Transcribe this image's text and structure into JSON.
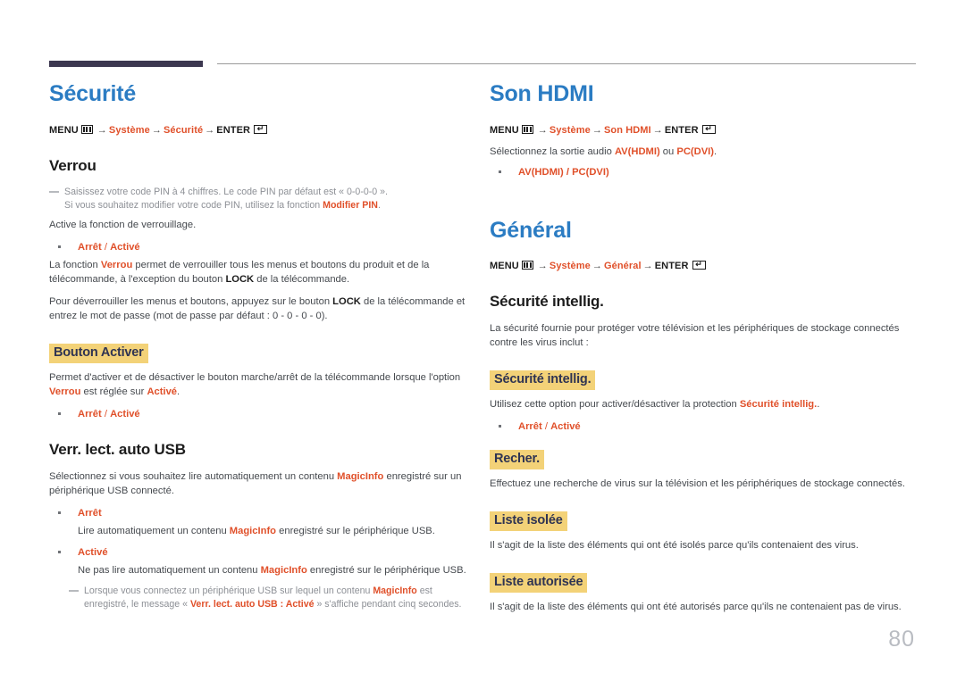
{
  "page": {
    "number": "80"
  },
  "left_column": {
    "title": "Sécurité",
    "menu_path": {
      "menu_label": "MENU",
      "arrow": "→",
      "item1": "Système",
      "item2": "Sécurité",
      "enter_label": "ENTER"
    },
    "verrou": {
      "heading": "Verrou",
      "note1_part1": "Saisissez votre code PIN à 4 chiffres. Le code PIN par défaut est « 0-0-0-0 ».",
      "note1_part2": "Si vous souhaitez modifier votre code PIN, utilisez la fonction ",
      "note1_accent": "Modifier PIN",
      "note1_part3": ".",
      "intro": "Active la fonction de verrouillage.",
      "bullet_off": "Arrêt",
      "bullet_sep": " / ",
      "bullet_on": "Activé",
      "para1_part1": "La fonction ",
      "para1_accent1": "Verrou",
      "para1_part2": " permet de verrouiller tous les menus et boutons du produit et de la télécommande, à l'exception du bouton ",
      "para1_bold1": "LOCK",
      "para1_part3": " de la télécommande.",
      "para2_part1": "Pour déverrouiller les menus et boutons, appuyez sur le bouton ",
      "para2_bold1": "LOCK",
      "para2_part2": " de la télécommande et entrez le mot de passe (mot de passe par défaut : 0 - 0 - 0 - 0)."
    },
    "bouton_activer": {
      "label": "Bouton Activer",
      "para_part1": "Permet d'activer et de désactiver le bouton marche/arrêt de la télécommande lorsque l'option ",
      "para_accent1": "Verrou",
      "para_part2": " est réglée sur ",
      "para_accent2": "Activé",
      "para_part3": ".",
      "bullet_off": "Arrêt",
      "bullet_sep": " / ",
      "bullet_on": "Activé"
    },
    "verr_lect": {
      "heading": "Verr. lect. auto USB",
      "intro_part1": "Sélectionnez si vous souhaitez lire automatiquement un contenu ",
      "intro_accent": "MagicInfo",
      "intro_part2": " enregistré sur un périphérique USB connecté.",
      "option1_label": "Arrêt",
      "option1_desc_part1": "Lire automatiquement un contenu ",
      "option1_desc_accent": "MagicInfo",
      "option1_desc_part2": " enregistré sur le périphérique USB.",
      "option2_label": "Activé",
      "option2_desc_part1": "Ne pas lire automatiquement un contenu ",
      "option2_desc_accent": "MagicInfo",
      "option2_desc_part2": " enregistré sur le périphérique USB.",
      "note_part1": "Lorsque vous connectez un périphérique USB sur lequel un contenu ",
      "note_accent1": "MagicInfo",
      "note_part2": " est enregistré, le message « ",
      "note_accent2": "Verr. lect. auto USB : Activé",
      "note_part3": " » s'affiche pendant cinq secondes."
    }
  },
  "right_column": {
    "son_hdmi": {
      "title": "Son HDMI",
      "menu_path": {
        "menu_label": "MENU",
        "arrow": "→",
        "item1": "Système",
        "item2": "Son HDMI",
        "enter_label": "ENTER"
      },
      "intro_part1": "Sélectionnez la sortie audio ",
      "intro_accent1": "AV(HDMI)",
      "intro_part2": " ou ",
      "intro_accent2": "PC(DVI)",
      "intro_part3": ".",
      "bullet": "AV(HDMI) / PC(DVI)"
    },
    "general": {
      "title": "Général",
      "menu_path": {
        "menu_label": "MENU",
        "arrow": "→",
        "item1": "Système",
        "item2": "Général",
        "enter_label": "ENTER"
      },
      "heading": "Sécurité intellig.",
      "intro": "La sécurité fournie pour protéger votre télévision et les périphériques de stockage connectés contre les virus inclut :",
      "securite_intellig": {
        "label": "Sécurité intellig.",
        "para_part1": "Utilisez cette option pour activer/désactiver la protection ",
        "para_accent": "Sécurité intellig.",
        "para_part2": ".",
        "bullet_off": "Arrêt",
        "bullet_sep": " / ",
        "bullet_on": "Activé"
      },
      "recher": {
        "label": "Recher.",
        "para": "Effectuez une recherche de virus sur la télévision et les périphériques de stockage connectés."
      },
      "liste_isolee": {
        "label": "Liste isolée",
        "para": "Il s'agit de la liste des éléments qui ont été isolés parce qu'ils contenaient des virus."
      },
      "liste_autorisee": {
        "label": "Liste autorisée",
        "para": "Il s'agit de la liste des éléments qui ont été autorisés parce qu'ils ne contenaient pas de virus."
      }
    }
  },
  "colors": {
    "heading_blue": "#2b7cc3",
    "accent_orange": "#e0502a",
    "highlight_yellow": "#f3d278",
    "highlight_text": "#2f3452",
    "rule_purple": "#3c3750",
    "page_number_gray": "#b9bcc2"
  }
}
